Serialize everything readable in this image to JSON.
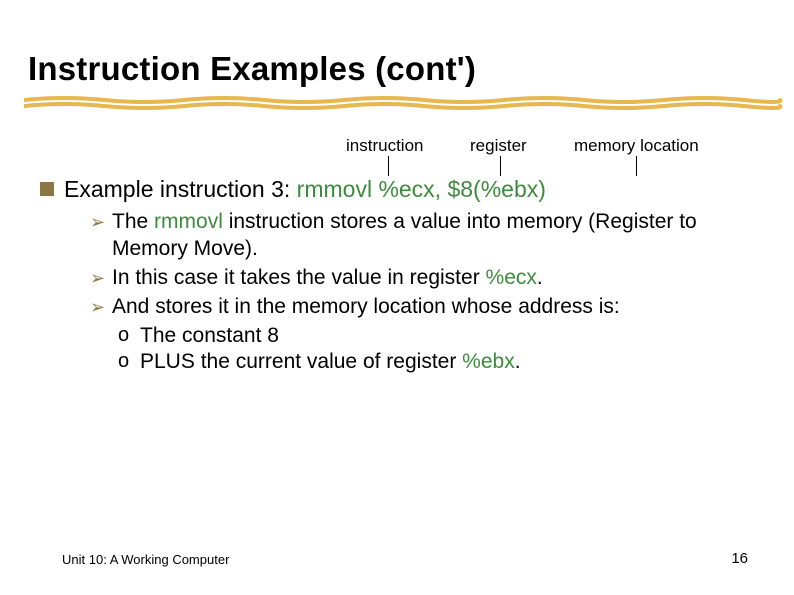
{
  "title": "Instruction Examples (cont')",
  "labels": {
    "instruction": "instruction",
    "register": "register",
    "memory": "memory location"
  },
  "example": {
    "lead": "Example instruction 3: ",
    "code": "rmmovl %ecx, $8(%ebx)"
  },
  "bullets": {
    "b1_a": "The ",
    "b1_rmmovl": "rmmovl",
    "b1_b": " instruction stores a value into memory (Register to Memory Move).",
    "b2_a": "In this case it takes the value in register ",
    "b2_reg": "%ecx",
    "b2_b": ".",
    "b3": "And stores it in the memory location whose address is:",
    "b3_1": "The constant 8",
    "b3_2a": "PLUS the current value of register ",
    "b3_2reg": "%ebx",
    "b3_2b": "."
  },
  "footer": "Unit 10: A Working Computer",
  "page": "16"
}
